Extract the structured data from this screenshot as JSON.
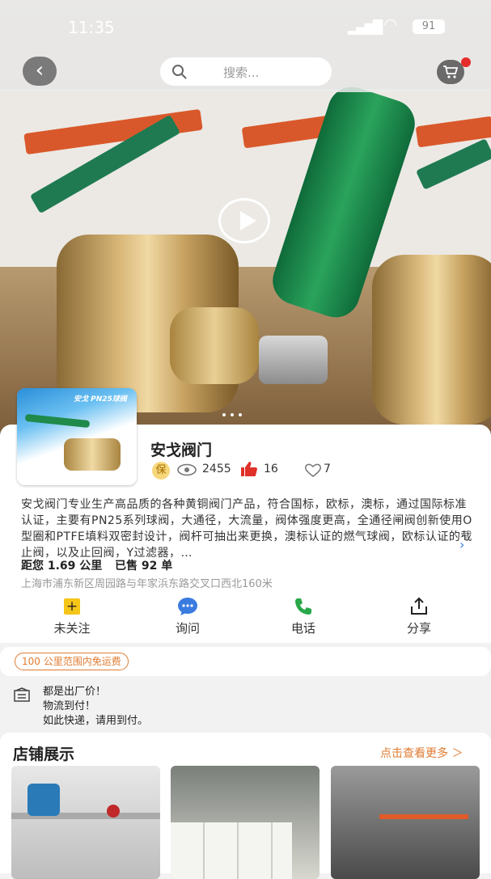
{
  "status_bar": {
    "time": "11:35",
    "battery": "91"
  },
  "header": {
    "search_placeholder": "搜索..."
  },
  "hero": {
    "badge_text": "安戈 PN25球阀"
  },
  "shop": {
    "name": "安戈阀门",
    "guarantee_label": "保",
    "views": "2455",
    "likes": "16",
    "shares": "7",
    "description": "安戈阀门专业生产高品质的各种黄铜阀门产品，符合国标，欧标，澳标，通过国际标准认证，主要有PN25系列球阀，大通径，大流量，阀体强度更高，全通径闸阀创新使用O型圈和PTFE填料双密封设计，阀杆可抽出来更换，澳标认证的燃气球阀，欧标认证的截止阀，以及止回阀，Y过滤器，…",
    "distance_text": "距您 1.69 公里",
    "sold_text": "已售 92 单",
    "address": "上海市浦东新区周园路与年家浜东路交叉口西北160米"
  },
  "actions": [
    {
      "label": "未关注",
      "icon": "follow-plus-icon",
      "color": "#f5c518"
    },
    {
      "label": "询问",
      "icon": "chat-bubble-icon",
      "color": "#3a7be0"
    },
    {
      "label": "电话",
      "icon": "phone-icon",
      "color": "#2aa84a"
    },
    {
      "label": "分享",
      "icon": "share-icon",
      "color": "#222222"
    }
  ],
  "shipping": {
    "badge": "100 公里范围内免运费"
  },
  "notes": [
    "都是出厂价！",
    "物流到付！",
    "如此快递，请用到付。"
  ],
  "store_display": {
    "title": "店铺展示",
    "more_link": "点击查看更多 ＞"
  },
  "colors": {
    "accent": "#e07b30",
    "valve_green": "#1f8a4a",
    "like_red": "#e0302a"
  }
}
